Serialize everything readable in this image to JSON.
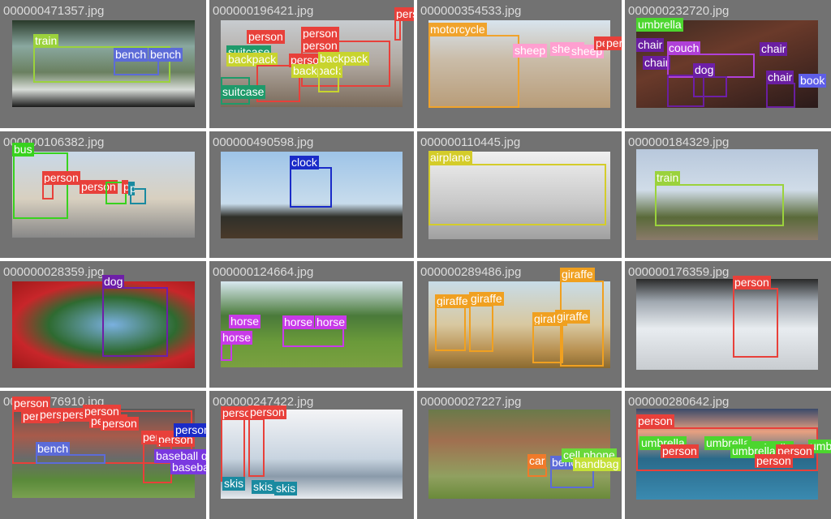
{
  "colors": {
    "person": "#e8403a",
    "train": "#9bd23c",
    "bench": "#5c6bd8",
    "suitcase": "#1e9a6a",
    "backpack": "#c8d42e",
    "motorcycle": "#f0a32c",
    "sheep": "#ff9fd0",
    "umbrella": "#4cd62e",
    "chair": "#6a1ea0",
    "couch": "#b040d8",
    "dog": "#6e1fa8",
    "book": "#5e5ee8",
    "bus": "#38d21e",
    "clock": "#1a2bc8",
    "airplane": "#d4cc2a",
    "horse": "#c83ae8",
    "giraffe": "#f0a020",
    "baseball glove": "#7a38e0",
    "skis": "#1a8aa0",
    "car": "#f07a2a",
    "cell phone": "#6ad83a",
    "handbag": "#c4e036"
  },
  "tiles": [
    {
      "filename": "000000471357.jpg",
      "labels": [
        "train",
        "bench",
        "bench"
      ]
    },
    {
      "filename": "000000196421.jpg",
      "labels": [
        "person",
        "person",
        "person",
        "person",
        "suitcase",
        "backpack",
        "person",
        "backpack",
        "backpack",
        "suitcase"
      ]
    },
    {
      "filename": "000000354533.jpg",
      "labels": [
        "motorcycle",
        "sheep",
        "sheep",
        "sheep",
        "person",
        "person"
      ]
    },
    {
      "filename": "000000232720.jpg",
      "labels": [
        "umbrella",
        "chair",
        "chair",
        "couch",
        "chair",
        "dog",
        "chair",
        "chair",
        "book"
      ]
    },
    {
      "filename": "000000106382.jpg",
      "labels": [
        "bus",
        "person",
        "person",
        "person",
        "person"
      ]
    },
    {
      "filename": "000000490598.jpg",
      "labels": [
        "clock"
      ]
    },
    {
      "filename": "000000110445.jpg",
      "labels": [
        "airplane"
      ]
    },
    {
      "filename": "000000184329.jpg",
      "labels": [
        "train"
      ]
    },
    {
      "filename": "000000028359.jpg",
      "labels": [
        "dog"
      ]
    },
    {
      "filename": "000000124664.jpg",
      "labels": [
        "horse",
        "horse",
        "horse",
        "horse"
      ]
    },
    {
      "filename": "000000289486.jpg",
      "labels": [
        "giraffe",
        "giraffe",
        "giraffe",
        "giraffe",
        "giraffe"
      ]
    },
    {
      "filename": "000000176359.jpg",
      "labels": [
        "person"
      ]
    },
    {
      "filename": "000000176910.jpg",
      "labels": [
        "person",
        "person",
        "person",
        "person",
        "person",
        "person",
        "person",
        "bench",
        "person",
        "person",
        "person",
        "baseball glove",
        "baseball glove"
      ]
    },
    {
      "filename": "000000247422.jpg",
      "labels": [
        "person",
        "person",
        "skis",
        "skis",
        "skis"
      ]
    },
    {
      "filename": "000000027227.jpg",
      "labels": [
        "car",
        "bench",
        "cell phone",
        "handbag"
      ]
    },
    {
      "filename": "000000280642.jpg",
      "labels": [
        "person",
        "umbrella",
        "umbrella",
        "umbrella",
        "umbrella",
        "person",
        "person",
        "person",
        "umbrella"
      ]
    }
  ]
}
